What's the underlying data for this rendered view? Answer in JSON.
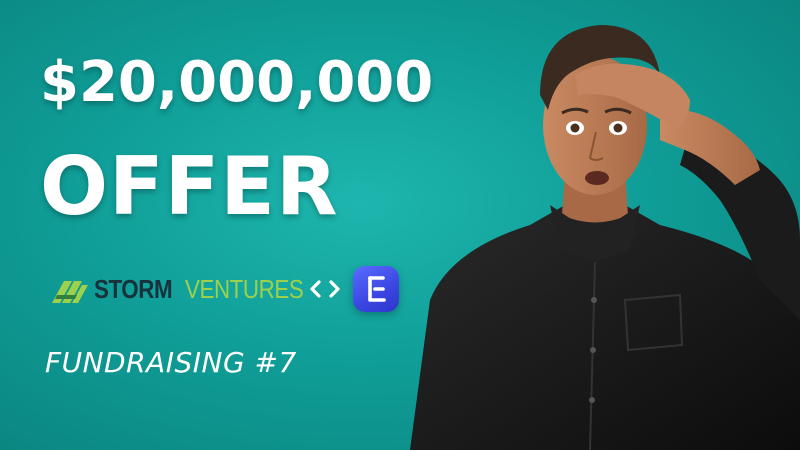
{
  "headline": {
    "amount": "$20,000,000",
    "offer": "OFFER"
  },
  "logos": {
    "storm_word_a": "STORM",
    "storm_word_b": "VENTURES",
    "link_icon": "chevrons-left-right-icon",
    "app_icon": "letter-e-app-icon"
  },
  "subtitle": "FUNDRAISING #7",
  "colors": {
    "background": "#14a9a2",
    "headline_text": "#ffffff",
    "storm_dark": "#17323a",
    "storm_green": "#9ed14b",
    "app_icon_blue": "#4451ec"
  },
  "image": {
    "subject": "surprised-man-hand-on-forehead"
  }
}
